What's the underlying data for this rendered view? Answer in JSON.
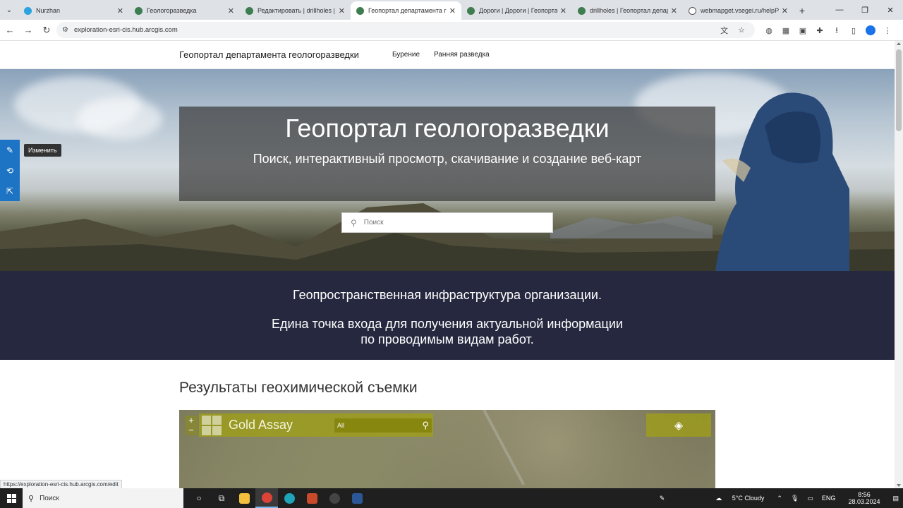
{
  "browser": {
    "tabs": [
      {
        "label": "Nurzhan",
        "favicon": "telegram-icon"
      },
      {
        "label": "Геологоразведка",
        "favicon": "arcgis-icon"
      },
      {
        "label": "Редактировать | drillholes | Ге",
        "favicon": "arcgis-icon"
      },
      {
        "label": "Геопортал департамента геол",
        "favicon": "arcgis-icon",
        "active": true
      },
      {
        "label": "Дороги | Дороги | Геопортал д",
        "favicon": "arcgis-icon"
      },
      {
        "label": "drillholes | Геопортал департа",
        "favicon": "arcgis-icon"
      },
      {
        "label": "webmapget.vsegei.ru/helpPage",
        "favicon": "globe-icon"
      }
    ],
    "url": "exploration-esri-cis.hub.arcgis.com",
    "status_url": "https://exploration-esri-cis.hub.arcgis.com/edit"
  },
  "site": {
    "title": "Геопортал департамента геологоразведки",
    "nav": [
      "Бурение",
      "Ранняя разведка"
    ],
    "tooltip": "Изменить"
  },
  "hero": {
    "title": "Геопортал геологоразведки",
    "subtitle": "Поиск, интерактивный просмотр, скачивание и создание веб-карт",
    "search_placeholder": "Поиск"
  },
  "band": {
    "line1": "Геопространственная инфраструктура организации.",
    "line2a": "Едина точка входа для получения актуальной информации",
    "line2b": "по проводимым видам работ."
  },
  "section": {
    "title": "Результаты геохимической съемки"
  },
  "map": {
    "title": "Gold Assay",
    "filter_value": "All",
    "accent": "#a0a014"
  },
  "taskbar": {
    "search_label": "Поиск",
    "weather": "5°C  Cloudy",
    "lang": "ENG",
    "time": "8:56",
    "date": "28.03.2024"
  }
}
